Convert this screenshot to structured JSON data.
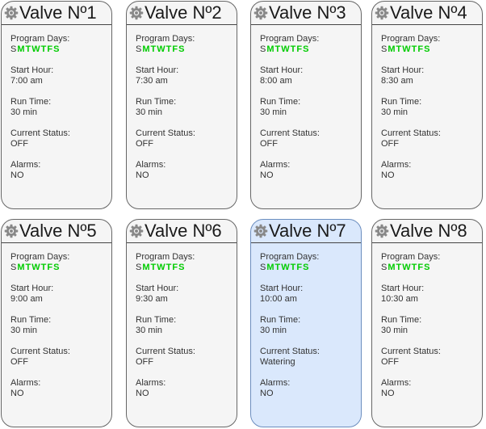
{
  "colors": {
    "card_bg": "#f5f5f5",
    "card_active_bg": "#dae8fc",
    "card_active_border": "#6c8ebf",
    "day_on": "#00cc00",
    "gear": "#888888"
  },
  "labels": {
    "program_days": "Program Days:",
    "start_hour": "Start Hour:",
    "run_time": "Run Time:",
    "current_status": "Current Status:",
    "alarms": "Alarms:"
  },
  "icon": "gear-icon",
  "valves": [
    {
      "title": "Valve Nº1",
      "days": [
        {
          "d": "S",
          "on": false
        },
        {
          "d": "M",
          "on": true
        },
        {
          "d": "T",
          "on": true
        },
        {
          "d": "W",
          "on": true
        },
        {
          "d": "T",
          "on": true
        },
        {
          "d": "F",
          "on": true
        },
        {
          "d": "S",
          "on": true
        }
      ],
      "start_hour": "7:00 am",
      "run_time": "30 min",
      "status": "OFF",
      "alarms": "NO",
      "active": false
    },
    {
      "title": "Valve Nº2",
      "days": [
        {
          "d": "S",
          "on": false
        },
        {
          "d": "M",
          "on": true
        },
        {
          "d": "T",
          "on": true
        },
        {
          "d": "W",
          "on": true
        },
        {
          "d": "T",
          "on": true
        },
        {
          "d": "F",
          "on": true
        },
        {
          "d": "S",
          "on": true
        }
      ],
      "start_hour": "7:30 am",
      "run_time": "30 min",
      "status": "OFF",
      "alarms": "NO",
      "active": false
    },
    {
      "title": "Valve Nº3",
      "days": [
        {
          "d": "S",
          "on": false
        },
        {
          "d": "M",
          "on": true
        },
        {
          "d": "T",
          "on": true
        },
        {
          "d": "W",
          "on": true
        },
        {
          "d": "T",
          "on": true
        },
        {
          "d": "F",
          "on": true
        },
        {
          "d": "S",
          "on": true
        }
      ],
      "start_hour": "8:00 am",
      "run_time": "30 min",
      "status": "OFF",
      "alarms": "NO",
      "active": false
    },
    {
      "title": "Valve Nº4",
      "days": [
        {
          "d": "S",
          "on": false
        },
        {
          "d": "M",
          "on": true
        },
        {
          "d": "T",
          "on": true
        },
        {
          "d": "W",
          "on": true
        },
        {
          "d": "T",
          "on": true
        },
        {
          "d": "F",
          "on": true
        },
        {
          "d": "S",
          "on": true
        }
      ],
      "start_hour": "8:30 am",
      "run_time": "30 min",
      "status": "OFF",
      "alarms": "NO",
      "active": false
    },
    {
      "title": "Valve Nº5",
      "days": [
        {
          "d": "S",
          "on": false
        },
        {
          "d": "M",
          "on": true
        },
        {
          "d": "T",
          "on": true
        },
        {
          "d": "W",
          "on": true
        },
        {
          "d": "T",
          "on": true
        },
        {
          "d": "F",
          "on": true
        },
        {
          "d": "S",
          "on": true
        }
      ],
      "start_hour": "9:00 am",
      "run_time": "30 min",
      "status": "OFF",
      "alarms": "NO",
      "active": false
    },
    {
      "title": "Valve Nº6",
      "days": [
        {
          "d": "S",
          "on": false
        },
        {
          "d": "M",
          "on": true
        },
        {
          "d": "T",
          "on": true
        },
        {
          "d": "W",
          "on": true
        },
        {
          "d": "T",
          "on": true
        },
        {
          "d": "F",
          "on": true
        },
        {
          "d": "S",
          "on": true
        }
      ],
      "start_hour": "9:30 am",
      "run_time": "30 min",
      "status": "OFF",
      "alarms": "NO",
      "active": false
    },
    {
      "title": "Valve Nº7",
      "days": [
        {
          "d": "S",
          "on": false
        },
        {
          "d": "M",
          "on": true
        },
        {
          "d": "T",
          "on": true
        },
        {
          "d": "W",
          "on": true
        },
        {
          "d": "T",
          "on": true
        },
        {
          "d": "F",
          "on": true
        },
        {
          "d": "S",
          "on": true
        }
      ],
      "start_hour": "10:00 am",
      "run_time": "30 min",
      "status": "Watering",
      "alarms": "NO",
      "active": true
    },
    {
      "title": "Valve Nº8",
      "days": [
        {
          "d": "S",
          "on": false
        },
        {
          "d": "M",
          "on": true
        },
        {
          "d": "T",
          "on": true
        },
        {
          "d": "W",
          "on": true
        },
        {
          "d": "T",
          "on": true
        },
        {
          "d": "F",
          "on": true
        },
        {
          "d": "S",
          "on": true
        }
      ],
      "start_hour": "10:30 am",
      "run_time": "30 min",
      "status": "OFF",
      "alarms": "NO",
      "active": false
    }
  ]
}
